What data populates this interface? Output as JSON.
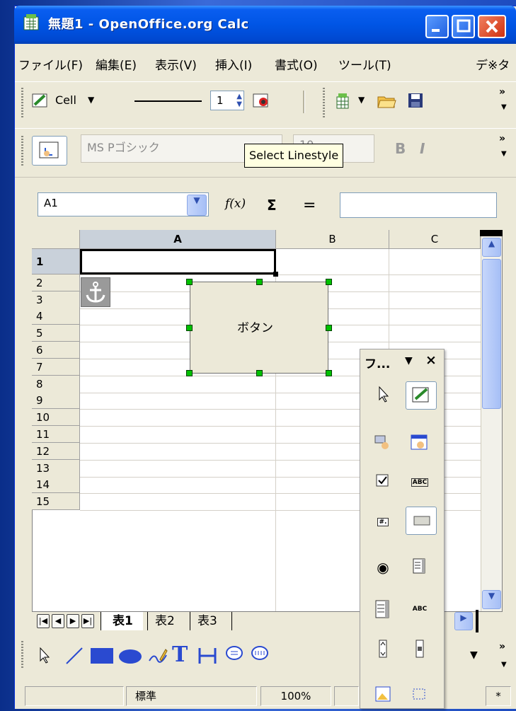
{
  "window": {
    "title": "無題1 - OpenOffice.org Calc"
  },
  "menu": [
    "ファイル(F)",
    "編集(E)",
    "表示(V)",
    "挿入(I)",
    "書式(O)",
    "ツール(T)",
    "デ※タ"
  ],
  "toolbar1": {
    "style_label": "Cell",
    "line_width_value": "1"
  },
  "toolbar2": {
    "font_name": "MS Pゴシック",
    "font_size": "10",
    "bold": "B",
    "italic": "I"
  },
  "tooltip": "Select Linestyle",
  "formula_bar": {
    "name_box": "A1",
    "fx": "f(x)",
    "sum": "Σ",
    "equals": "=",
    "input": ""
  },
  "grid": {
    "columns": [
      "A",
      "B",
      "C"
    ],
    "rows": [
      "1",
      "2",
      "3",
      "4",
      "5",
      "6",
      "7",
      "8",
      "9",
      "10",
      "11",
      "12",
      "13",
      "14",
      "15"
    ],
    "active_cell": "A1"
  },
  "form_button": {
    "label": "ボタン"
  },
  "controls_toolbar": {
    "title": "フ...",
    "close": "×",
    "dropdown": "▼"
  },
  "sheet_tabs": [
    "表1",
    "表2",
    "表3"
  ],
  "status_bar": {
    "style": "標準",
    "zoom": "100%",
    "mode": "*"
  },
  "colors": {
    "titlebar": "#0055e5",
    "handle": "#00c000",
    "chrome": "#ece9d8"
  }
}
